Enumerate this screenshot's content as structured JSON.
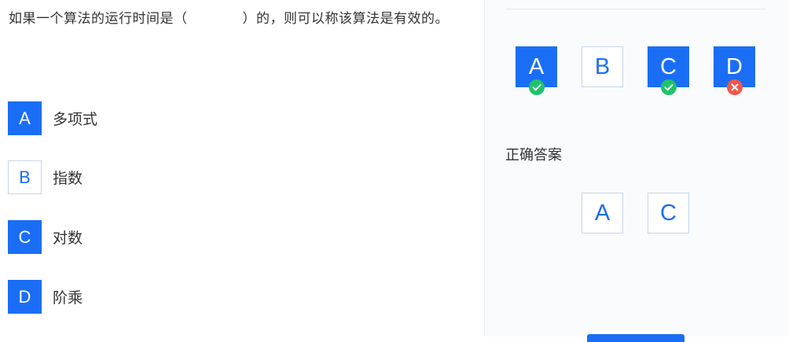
{
  "question": {
    "text_before": "如果一个算法的运行时间是（",
    "text_after": "）的，则可以称该算法是有效的。"
  },
  "options": [
    {
      "letter": "A",
      "text": "多项式",
      "selected": true
    },
    {
      "letter": "B",
      "text": "指数",
      "selected": false
    },
    {
      "letter": "C",
      "text": "对数",
      "selected": true
    },
    {
      "letter": "D",
      "text": "阶乘",
      "selected": true
    }
  ],
  "user_answers": [
    {
      "letter": "A",
      "filled": true,
      "mark": "check-icon"
    },
    {
      "letter": "B",
      "filled": false,
      "mark": ""
    },
    {
      "letter": "C",
      "filled": true,
      "mark": "check-icon"
    },
    {
      "letter": "D",
      "filled": true,
      "mark": "cross-icon"
    }
  ],
  "correct_answer": {
    "title": "正确答案",
    "letters": [
      "A",
      "C"
    ]
  },
  "colors": {
    "accent": "#1a6ef5",
    "correct": "#1fc36b",
    "wrong": "#f2574a"
  }
}
